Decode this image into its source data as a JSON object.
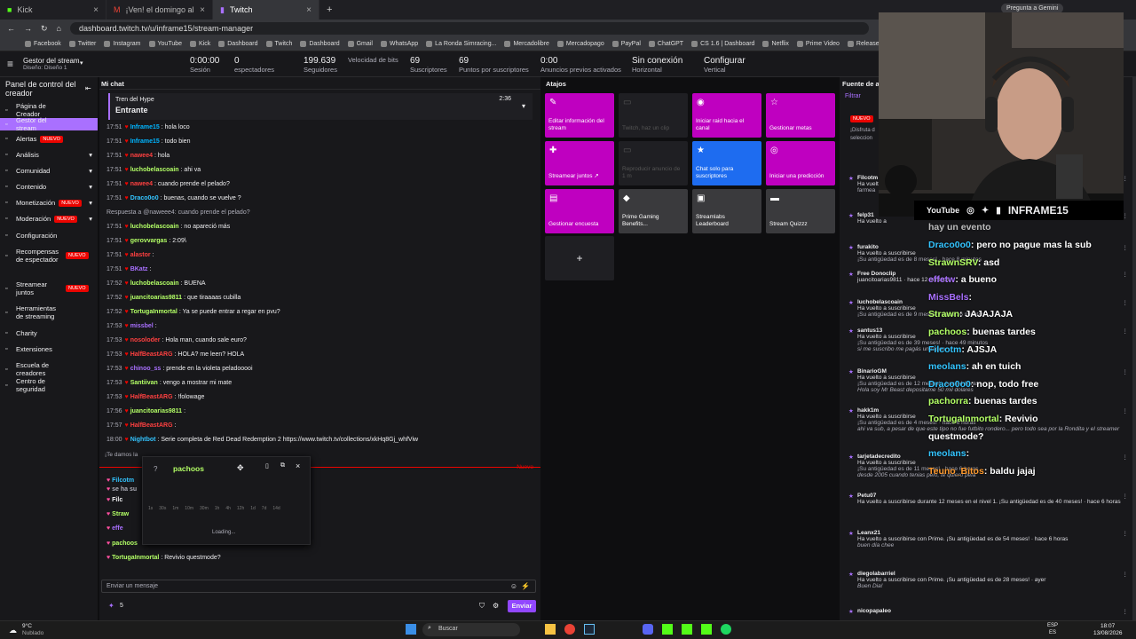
{
  "browser": {
    "tabs": [
      {
        "label": "Kick"
      },
      {
        "label": "¡Ven! el domingo al Monum"
      },
      {
        "label": "Twitch"
      }
    ],
    "url": "dashboard.twitch.tv/u/inframe15/stream-manager",
    "gemini": "Pregunta a Gemini",
    "bookmarks": [
      "Facebook",
      "Twitter",
      "Instagram",
      "YouTube",
      "Kick",
      "Dashboard",
      "Twitch",
      "Dashboard",
      "Gmail",
      "WhatsApp",
      "La Ronda Simracing...",
      "Mercadolibre",
      "Mercadopago",
      "PayPal",
      "ChatGPT",
      "CS 1.6 | Dashboard",
      "Netflix",
      "Prime Video",
      "Releases",
      "Amazon",
      "JUAN TURR"
    ]
  },
  "top": {
    "title": "Gestor del stream",
    "subtitle": "Diseño: Diseño 1",
    "stats": [
      {
        "v": "0:00:00",
        "l": "Sesión"
      },
      {
        "v": "0",
        "l": "espectadores"
      },
      {
        "v": "199.639",
        "l": "Seguidores"
      },
      {
        "v": "",
        "l": "Velocidad de bits"
      },
      {
        "v": "69",
        "l": "Suscriptores"
      },
      {
        "v": "69",
        "l": "Puntos por suscriptores"
      },
      {
        "v": "0:00",
        "l": "Anuncios previos activados"
      },
      {
        "v": "Sin conexión",
        "l": "Horizontal"
      },
      {
        "v": "Configurar",
        "l": "Vertical"
      }
    ]
  },
  "sidebar": {
    "header": "Panel de control del creador",
    "items": [
      {
        "label": "Página de Creador"
      },
      {
        "label": "Gestor del stream"
      },
      {
        "label": "Alertas",
        "badge": "NUEVO"
      },
      {
        "label": "Análisis"
      },
      {
        "label": "Comunidad"
      },
      {
        "label": "Contenido"
      },
      {
        "label": "Monetización",
        "badge": "NUEVO"
      },
      {
        "label": "Moderación",
        "badge": "NUEVO"
      },
      {
        "label": "Configuración"
      },
      {
        "label": "Recompensas de espectador",
        "badge": "NUEVO"
      },
      {
        "label": "Streamear juntos",
        "badge": "NUEVO"
      },
      {
        "label": "Herramientas de streaming"
      },
      {
        "label": "Charity"
      },
      {
        "label": "Extensiones"
      },
      {
        "label": "Escuela de creadores"
      },
      {
        "label": "Centro de seguridad"
      }
    ]
  },
  "chat": {
    "header": "Mi chat",
    "hype_title": "Tren del Hype",
    "hype_state": "Entrante",
    "hype_time": "2:36",
    "messages": [
      {
        "t": "17:51",
        "u": "Inframe15",
        "c": "#00b5ff",
        "m": ": hola loco"
      },
      {
        "t": "17:51",
        "u": "Inframe15",
        "c": "#00b5ff",
        "m": ": todo bien"
      },
      {
        "t": "17:51",
        "u": "nawee4",
        "c": "#ff4040",
        "m": ": hola"
      },
      {
        "t": "17:51",
        "u": "luchobelascoain",
        "c": "#b3ff66",
        "m": ": ahi va"
      },
      {
        "t": "17:51",
        "u": "nawee4",
        "c": "#ff4040",
        "m": ": cuando prende el pelado?"
      },
      {
        "t": "17:51",
        "u": "Draco0o0",
        "c": "#33c4ff",
        "m": ": buenas, cuando se vuelve ?"
      },
      {
        "t": "",
        "u": "",
        "c": "#adadb8",
        "m": "Respuesta a @naweee4: cuando prende el pelado?"
      },
      {
        "t": "17:51",
        "u": "luchobelascoain",
        "c": "#b3ff66",
        "m": ": no apareció más"
      },
      {
        "t": "17:51",
        "u": "gerovvargas",
        "c": "#b3ff66",
        "m": ": 2:09\\"
      },
      {
        "t": "17:51",
        "u": "alastor",
        "c": "#ff4040",
        "m": ":"
      },
      {
        "t": "17:51",
        "u": "BKatz",
        "c": "#a970ff",
        "m": ":"
      },
      {
        "t": "17:52",
        "u": "luchobelascoain",
        "c": "#b3ff66",
        "m": ": BUENA"
      },
      {
        "t": "17:52",
        "u": "juancitoarias9811",
        "c": "#b3ff66",
        "m": ": que tiraaaas cubilla"
      },
      {
        "t": "17:52",
        "u": "TortugaInmortal",
        "c": "#b3ff66",
        "m": ": Ya se puede entrar a regar en pvu?"
      },
      {
        "t": "17:53",
        "u": "missbel",
        "c": "#a970ff",
        "m": ":"
      },
      {
        "t": "17:53",
        "u": "nosoloder",
        "c": "#ff4040",
        "m": ": Hola man, cuando sale euro?"
      },
      {
        "t": "17:53",
        "u": "HalfBeastARG",
        "c": "#ff4040",
        "m": ": HOLA? me leen? HOLA"
      },
      {
        "t": "17:53",
        "u": "chinoo_ss",
        "c": "#a970ff",
        "m": ": prende en la violeta peladooooi"
      },
      {
        "t": "17:53",
        "u": "Santiivan",
        "c": "#b3ff66",
        "m": ": vengo a mostrar mi mate"
      },
      {
        "t": "17:53",
        "u": "HalfBeastARG",
        "c": "#ff4040",
        "m": ": !folowage"
      },
      {
        "t": "17:56",
        "u": "juancitoarias9811",
        "c": "#b3ff66",
        "m": ":"
      },
      {
        "t": "17:57",
        "u": "HalfBeastARG",
        "c": "#ff4040",
        "m": ":"
      },
      {
        "t": "18:00",
        "u": "Nightbot",
        "c": "#33c4ff",
        "m": ": Serie completa de Red Dead Redemption 2 https://www.twitch.tv/collections/xkHq8Gj_whfViw"
      }
    ],
    "truncated": "¡Te damos la",
    "new_label": "Nuevo",
    "bottom": [
      {
        "u": "Filcotm",
        "c": "#33c4ff",
        "m": ""
      },
      {
        "u": "se ha su",
        "c": "#adadb8",
        "m": ""
      },
      {
        "u": "Filc",
        "c": "#efeff1",
        "m": ""
      },
      {
        "u": "Straw",
        "c": "#b3ff66",
        "m": ""
      },
      {
        "u": "effe",
        "c": "#a970ff",
        "m": ""
      },
      {
        "u": "pachoos",
        "c": "#b3ff66",
        "m": ""
      },
      {
        "u": "TortugaInmortal",
        "c": "#b3ff66",
        "m": ": Revivio questmode?"
      }
    ],
    "popup_user": "pachoos",
    "popup_loading": "Loading...",
    "popup_times": [
      "1s",
      "30s",
      "1m",
      "10m",
      "30m",
      "1h",
      "4h",
      "12h",
      "1d",
      "7d",
      "14d"
    ],
    "input_placeholder": "Enviar un mensaje",
    "points": "5",
    "send": "Enviar"
  },
  "shortcuts": {
    "header": "Atajos",
    "tiles": [
      {
        "label": "Editar información del stream",
        "bg": "#bf00c0",
        "icon": "✎"
      },
      {
        "label": "Twitch, haz un clip",
        "bg": "#1f1f23",
        "icon": "▭"
      },
      {
        "label": "Iniciar raid hacia el canal",
        "bg": "#bf00c0",
        "icon": "◉"
      },
      {
        "label": "Gestionar metas",
        "bg": "#bf00c0",
        "icon": "☆"
      },
      {
        "label": "Streamear juntos ↗",
        "bg": "#bf00c0",
        "icon": "✚"
      },
      {
        "label": "Reproducir anuncio de 1 m",
        "bg": "#1f1f23",
        "icon": "▭"
      },
      {
        "label": "Chat solo para suscriptores",
        "bg": "#1e6cf0",
        "icon": "★"
      },
      {
        "label": "Iniciar una predicción",
        "bg": "#bf00c0",
        "icon": "◎"
      },
      {
        "label": "Gestionar encuesta",
        "bg": "#bf00c0",
        "icon": "▤"
      },
      {
        "label": "Prime Gaming Benefits...",
        "bg": "#3a3a3d",
        "icon": "◆"
      },
      {
        "label": "Streamlabs Leaderboard",
        "bg": "#3a3a3d",
        "icon": "▣"
      },
      {
        "label": "Stream Quizzz",
        "bg": "#3a3a3d",
        "icon": "▬"
      }
    ],
    "add": "+"
  },
  "activity": {
    "header": "Fuente de ac",
    "filter": "Filtrar",
    "new_badge": "NUEVO",
    "promo": "¡Disfruta d seleccion",
    "items": [
      {
        "n": "Filcotm",
        "d": "Ha vuelto a",
        "tm": "farmea"
      },
      {
        "n": "felp31",
        "d": "Ha vuelto a",
        "tm": ""
      },
      {
        "n": "furakito",
        "d": "Ha vuelto a suscribirse",
        "tm": "¡Su antigüedad es de 8 meses! · hace 8 minutos"
      },
      {
        "n": "Free Donoclip",
        "d": "juancitoarias9811 · hace 12 minutos",
        "tm": ""
      },
      {
        "n": "luchobelascoain",
        "d": "Ha vuelto a suscribirse",
        "tm": "¡Su antigüedad es de 9 meses! · hace 16 minutos"
      },
      {
        "n": "santus13",
        "d": "Ha vuelto a suscribirse",
        "tm": "¡Su antigüedad es de 39 meses! · hace 49 minutos",
        "q": "si me suscribo me pagás un tapon"
      },
      {
        "n": "BinarioGM",
        "d": "Ha vuelto a suscribirse",
        "tm": "¡Su antigüedad es de 12 meses! · hace 4 horas",
        "q": "Hola soy Mr Beast depositame 50 mil dolares"
      },
      {
        "n": "hakk1m",
        "d": "Ha vuelto a suscribirse",
        "tm": "¡Su antigüedad es de 4 meses! · hace 6 horas",
        "q": "ahi va sub, a pesar de que este tipo no fue futbito rondero... pero todo sea por la Rondita y el streamer"
      },
      {
        "n": "tarjetadecredito",
        "d": "Ha vuelto a suscribirse",
        "tm": "¡Su antigüedad es de 11 meses! · hace 6 horas",
        "q": "desde 2005 cuando tenias pelo, te quiero pela"
      },
      {
        "n": "Petu07",
        "d": "Ha vuelto a suscribirse durante 12 meses en el nivel 1. ¡Su antigüedad es de 40 meses! · hace 6 horas",
        "tm": ""
      },
      {
        "n": "Leanx21",
        "d": "Ha vuelto a suscribirse con Prime. ¡Su antigüedad es de 54 meses! · hace 6 horas",
        "tm": "",
        "q": "buen día chee"
      },
      {
        "n": "diegolabarriel",
        "d": "Ha vuelto a suscribirse con Prime. ¡Su antigüedad es de 28 meses! · ayer",
        "tm": "",
        "q": "Buen Dia!"
      },
      {
        "n": "nicopapaleo",
        "d": "",
        "tm": ""
      }
    ]
  },
  "overlay": {
    "social": "INFRAME15",
    "yt": "YouTube",
    "top": "hay un evento",
    "lines": [
      {
        "u": "Draco0o0",
        "c": "#33c4ff",
        "m": ": pero no pague mas la sub"
      },
      {
        "u": "StrawnSRV",
        "c": "#b3ff66",
        "m": ": asd"
      },
      {
        "u": "effetw",
        "c": "#a970ff",
        "m": ": a bueno"
      },
      {
        "u": "MissBels",
        "c": "#a970ff",
        "m": ":"
      },
      {
        "u": "Strawn",
        "c": "#b3ff66",
        "m": ": JAJAJAJA"
      },
      {
        "u": "pachoos",
        "c": "#b3ff66",
        "m": ": buenas tardes"
      },
      {
        "u": "Filcotm",
        "c": "#33c4ff",
        "m": ": AJSJA"
      },
      {
        "u": "meolans",
        "c": "#33c4ff",
        "m": ": ah en tuich"
      },
      {
        "u": "Draco0o0",
        "c": "#33c4ff",
        "m": ": nop, todo free"
      },
      {
        "u": "pachorra",
        "c": "#b3ff66",
        "m": ": buenas tardes"
      },
      {
        "u": "TortugaInmortal",
        "c": "#b3ff66",
        "m": ": Revivio"
      },
      {
        "u": "",
        "c": "#fff",
        "m": "questmode?"
      },
      {
        "u": "meolans",
        "c": "#33c4ff",
        "m": ":"
      },
      {
        "u": "Teuno_Bitos",
        "c": "#ff9a2e",
        "m": ": baldu jajaj"
      }
    ]
  },
  "taskbar": {
    "weather": "9°C",
    "weather2": "Nublado",
    "search": "Buscar",
    "lang": "ESP",
    "lang2": "ES",
    "time": "18:07",
    "date": "13/08/2026"
  }
}
